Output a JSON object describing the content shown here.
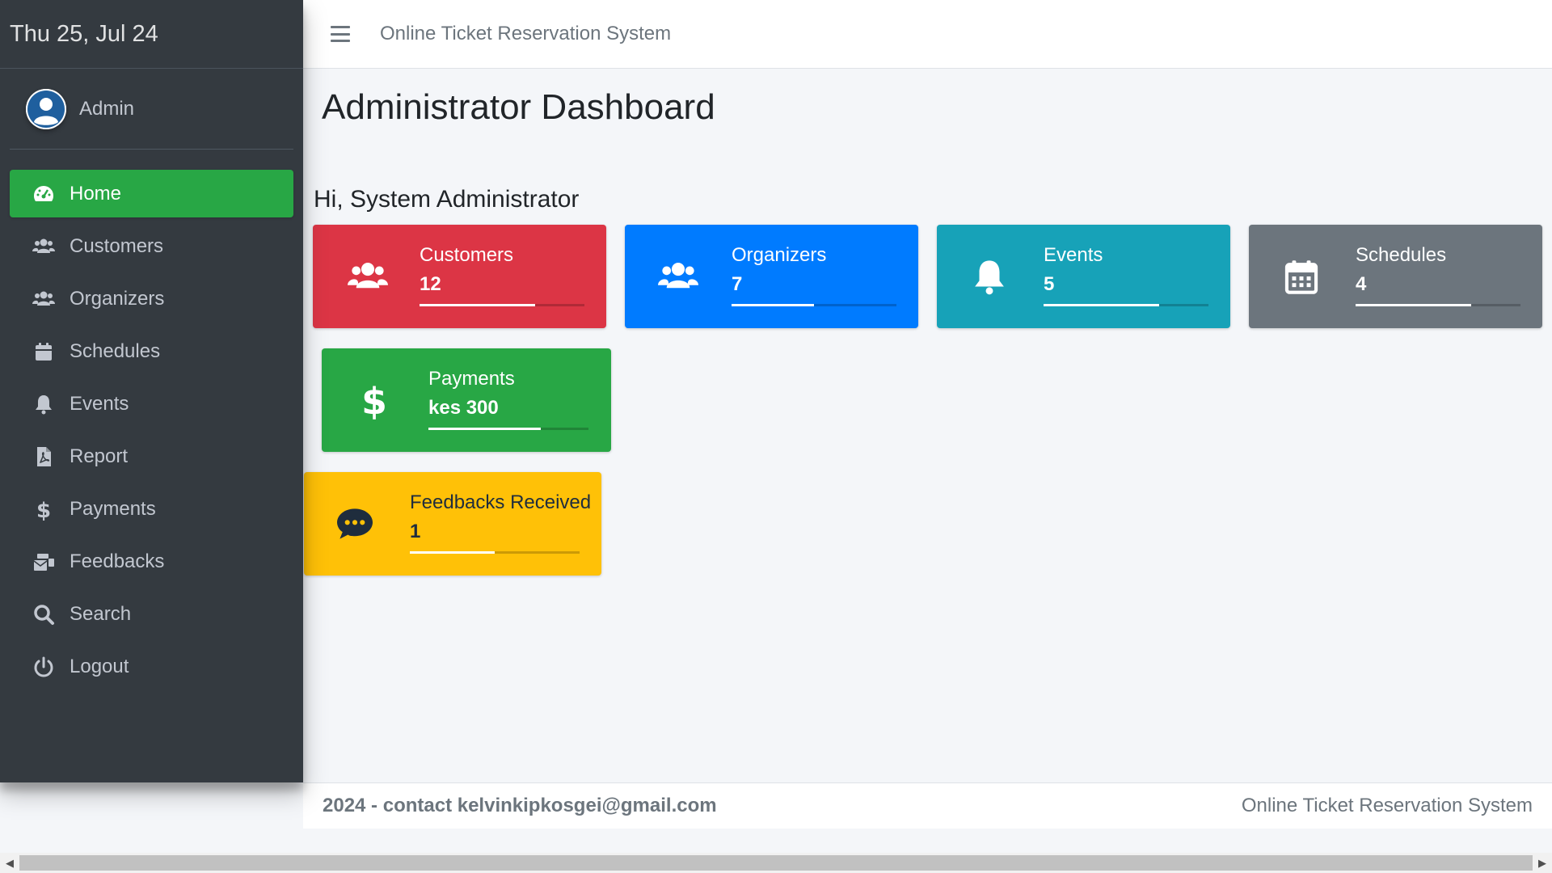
{
  "sidebar": {
    "date": "Thu 25, Jul 24",
    "user": "Admin",
    "items": [
      {
        "label": "Home",
        "icon": "tachometer-icon",
        "active": true
      },
      {
        "label": "Customers",
        "icon": "users-icon"
      },
      {
        "label": "Organizers",
        "icon": "users-icon"
      },
      {
        "label": "Schedules",
        "icon": "calendar-icon"
      },
      {
        "label": "Events",
        "icon": "bell-icon"
      },
      {
        "label": "Report",
        "icon": "pdf-file-icon"
      },
      {
        "label": "Payments",
        "icon": "dollar-icon"
      },
      {
        "label": "Feedbacks",
        "icon": "mail-bulk-icon"
      },
      {
        "label": "Search",
        "icon": "search-icon"
      },
      {
        "label": "Logout",
        "icon": "power-icon"
      }
    ]
  },
  "topbar": {
    "title": "Online Ticket Reservation System"
  },
  "main": {
    "title": "Administrator Dashboard",
    "greeting": "Hi, System Administrator",
    "cards": [
      {
        "label": "Customers",
        "value": "12",
        "color": "#dc3545",
        "icon": "users-icon",
        "progress": 0.7
      },
      {
        "label": "Organizers",
        "value": "7",
        "color": "#007bff",
        "icon": "users-icon",
        "progress": 0.5
      },
      {
        "label": "Events",
        "value": "5",
        "color": "#17a2b8",
        "icon": "bell-icon",
        "progress": 0.7
      },
      {
        "label": "Schedules",
        "value": "4",
        "color": "#6c757d",
        "icon": "calendar-icon",
        "progress": 0.7
      },
      {
        "label": "Payments",
        "value": "kes 300",
        "color": "#28a745",
        "icon": "dollar-icon",
        "progress": 0.7
      },
      {
        "label": "Feedbacks Received",
        "value": "1",
        "color": "#ffc107",
        "icon": "comment-dots-icon",
        "progress": 0.5
      }
    ]
  },
  "footer": {
    "left": "2024 - contact kelvinkipkosgei@gmail.com",
    "right": "Online Ticket Reservation System"
  }
}
